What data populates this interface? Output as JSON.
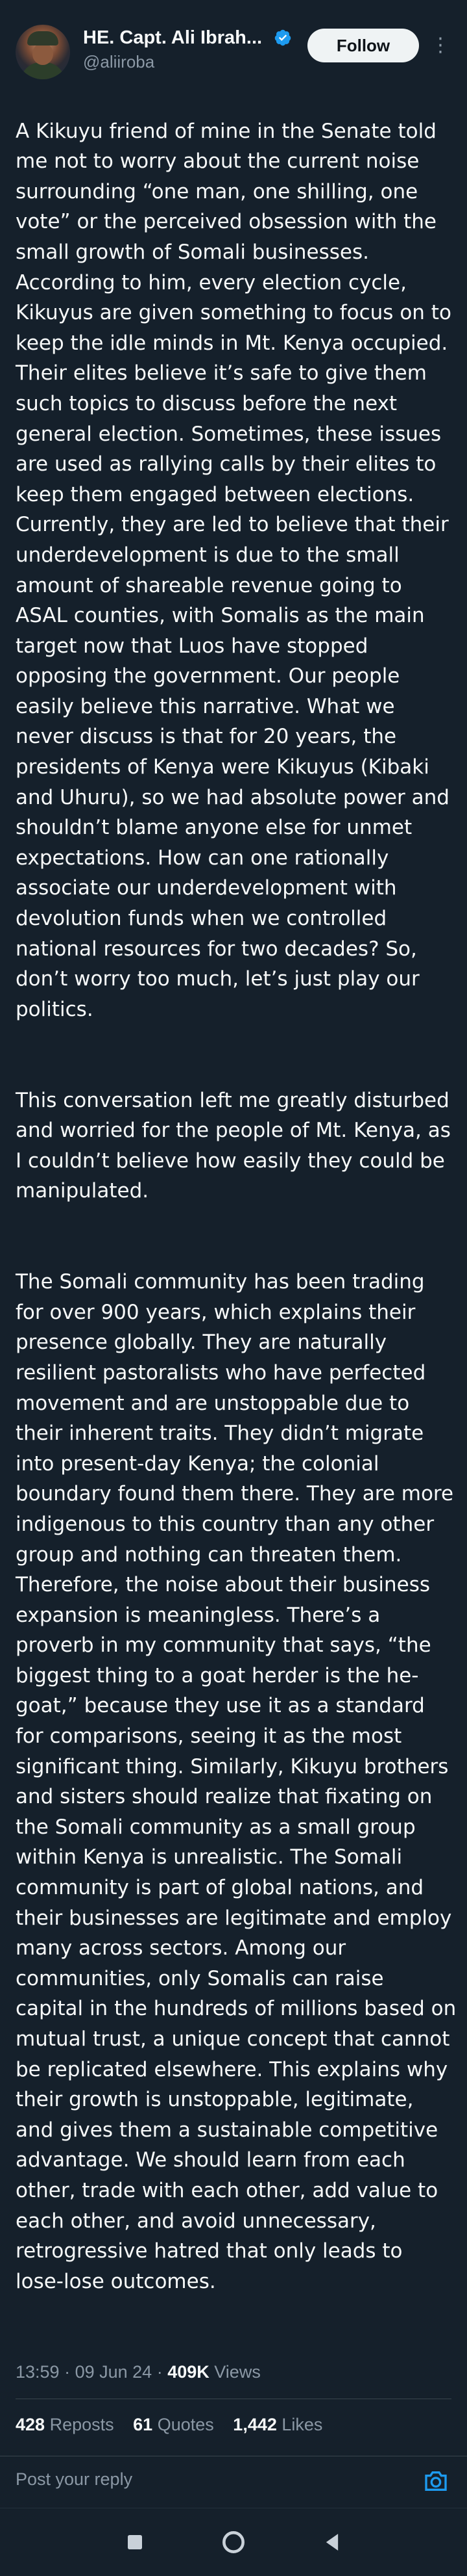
{
  "author": {
    "display_name": "HE. Capt. Ali Ibrah...",
    "handle": "@aliiroba",
    "verified": true
  },
  "header": {
    "follow_label": "Follow",
    "more_icon": "more-vertical-icon"
  },
  "tweet": {
    "paragraphs": [
      "A Kikuyu friend of mine in the Senate told me not to worry about the current noise surrounding “one man, one shilling, one vote” or the perceived obsession with the small growth of Somali businesses. According to him, every election cycle, Kikuyus are given something to focus on to keep the idle minds in Mt. Kenya occupied. Their elites believe it’s safe to give them such topics to discuss before the next general election. Sometimes, these issues are used as rallying calls by their elites to keep them engaged between elections. Currently, they are led to believe that their underdevelopment is due to the small amount of shareable revenue going to ASAL counties, with Somalis as the main target now that Luos have stopped opposing the government. Our people easily believe this narrative. What we never discuss is that for 20 years, the presidents of Kenya were Kikuyus (Kibaki and Uhuru), so we had absolute power and shouldn’t blame anyone else for unmet expectations. How can one rationally associate our underdevelopment with devolution funds when we controlled national resources for two decades? So, don’t worry too much, let’s just play our politics.",
      "This conversation left me greatly disturbed and worried for the people of Mt. Kenya, as I couldn’t believe how easily they could be manipulated.",
      "The Somali community has been trading for over 900 years, which explains their presence globally. They are naturally resilient pastoralists who have perfected movement and are unstoppable due to their inherent traits. They didn’t migrate into present-day Kenya; the colonial boundary found them there. They are more indigenous to this country than any other group and nothing can threaten them. Therefore, the noise about their business expansion is meaningless. There’s a proverb in my community that says, “the biggest thing to a goat herder is the he-goat,” because they use it as a standard for comparisons, seeing it as the most significant thing. Similarly, Kikuyu brothers and sisters should realize that fixating on the Somali community as a small group within Kenya is unrealistic. The Somali community is part of global nations, and their businesses are legitimate and employ many across sectors. Among our communities, only Somalis can raise capital in the hundreds of millions based on mutual trust, a unique concept that cannot be replicated elsewhere. This explains why their growth is unstoppable, legitimate, and gives them a sustainable competitive advantage. We should learn from each other, trade with each other, add value to each other, and avoid unnecessary, retrogressive hatred that only leads to lose-lose outcomes."
    ],
    "time": "13:59",
    "date": "09 Jun 24",
    "views_count": "409K",
    "views_label": "Views"
  },
  "stats": {
    "reposts_count": "428",
    "reposts_label": "Reposts",
    "quotes_count": "61",
    "quotes_label": "Quotes",
    "likes_count": "1,442",
    "likes_label": "Likes"
  },
  "reply": {
    "placeholder": "Post your reply"
  },
  "colors": {
    "background": "#15202b",
    "text": "#f7f9f9",
    "muted": "#8b98a5",
    "accent": "#1d9bf0",
    "divider": "#38444d"
  }
}
